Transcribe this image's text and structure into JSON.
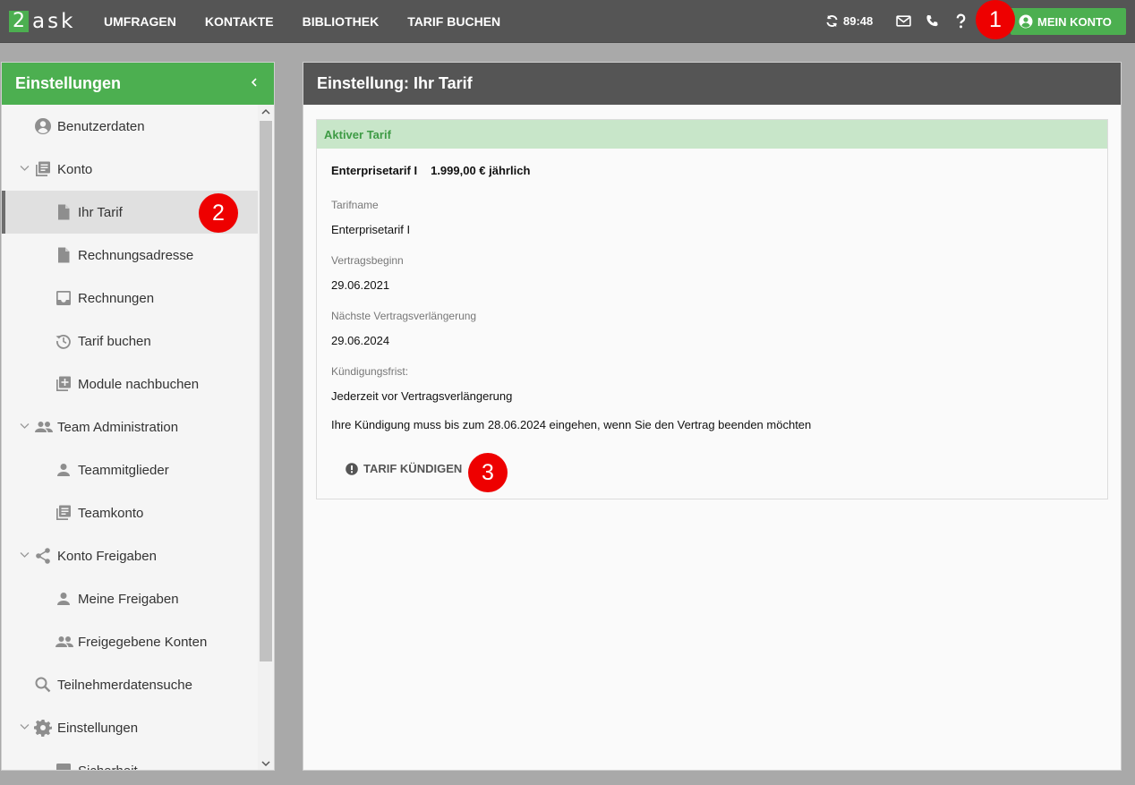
{
  "topbar": {
    "logo_digit": "2",
    "logo_text": "ask",
    "nav": [
      "UMFRAGEN",
      "KONTAKTE",
      "BIBLIOTHEK",
      "TARIF BUCHEN"
    ],
    "timer": "89:48",
    "account_button": "MEIN KONTO"
  },
  "markers": [
    "1",
    "2",
    "3"
  ],
  "sidebar": {
    "title": "Einstellungen",
    "items": [
      {
        "label": "Benutzerdaten",
        "icon": "account-circle-icon"
      },
      {
        "label": "Konto",
        "icon": "library-books-icon"
      },
      {
        "label": "Ihr Tarif",
        "icon": "file-icon"
      },
      {
        "label": "Rechnungsadresse",
        "icon": "file-icon"
      },
      {
        "label": "Rechnungen",
        "icon": "inbox-icon"
      },
      {
        "label": "Tarif buchen",
        "icon": "history-icon"
      },
      {
        "label": "Module nachbuchen",
        "icon": "library-add-icon"
      },
      {
        "label": "Team Administration",
        "icon": "people-icon"
      },
      {
        "label": "Teammitglieder",
        "icon": "person-icon"
      },
      {
        "label": "Teamkonto",
        "icon": "library-books-icon"
      },
      {
        "label": "Konto Freigaben",
        "icon": "share-icon"
      },
      {
        "label": "Meine Freigaben",
        "icon": "person-icon"
      },
      {
        "label": "Freigegebene Konten",
        "icon": "people-icon"
      },
      {
        "label": "Teilnehmerdatensuche",
        "icon": "search-icon"
      },
      {
        "label": "Einstellungen",
        "icon": "gear-icon"
      },
      {
        "label": "Sicherheit",
        "icon": "square-icon"
      }
    ]
  },
  "main": {
    "title": "Einstellung: Ihr Tarif",
    "card_title": "Aktiver Tarif",
    "plan_name": "Enterprisetarif I",
    "plan_price": "1.999,00 € jährlich",
    "fields": [
      {
        "label": "Tarifname",
        "value": "Enterprisetarif I"
      },
      {
        "label": "Vertragsbeginn",
        "value": "29.06.2021"
      },
      {
        "label": "Nächste Vertragsverlängerung",
        "value": "29.06.2024"
      },
      {
        "label": "Kündigungsfrist:",
        "value": "Jederzeit vor Vertragsverlängerung"
      }
    ],
    "notice": "Ihre Kündigung muss bis zum 28.06.2024 eingehen, wenn Sie den Vertrag beenden möchten",
    "cancel_button": "TARIF KÜNDIGEN"
  },
  "colors": {
    "brand_green": "#4caf50",
    "header_gray": "#555555",
    "card_head_bg": "#c8e6c9",
    "marker_red": "#ee0000"
  }
}
